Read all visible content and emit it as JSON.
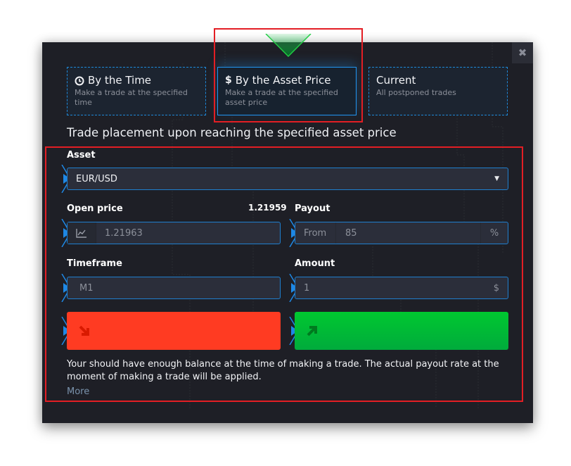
{
  "dialog": {
    "close_icon": "close-icon"
  },
  "tabs": [
    {
      "title": "By the Time",
      "description": "Make a trade at the specified time",
      "icon": "clock-icon",
      "active": false
    },
    {
      "title": "By the Asset Price",
      "description": "Make a trade at the specified asset price",
      "icon": "dollar-icon",
      "active": true
    },
    {
      "title": "Current",
      "description": "All postponed trades",
      "icon": "",
      "active": false
    }
  ],
  "heading": "Trade placement upon reaching the specified asset price",
  "form": {
    "asset": {
      "label": "Asset",
      "value": "EUR/USD"
    },
    "open_price": {
      "label": "Open price",
      "current_price": "1.21959",
      "value": "1.21963",
      "icon": "chart-line-icon"
    },
    "payout": {
      "label": "Payout",
      "prefix": "From",
      "value": "85",
      "suffix": "%"
    },
    "timeframe": {
      "label": "Timeframe",
      "value": "M1"
    },
    "amount": {
      "label": "Amount",
      "value": "1",
      "suffix": "$"
    },
    "sell_button": {
      "icon": "arrow-down-right-icon",
      "color": "#ff3b22"
    },
    "buy_button": {
      "icon": "arrow-up-right-icon",
      "color": "#00c032"
    }
  },
  "note": "Your should have enough balance at the time of making a trade. The actual payout rate at the moment of making a trade will be applied.",
  "more_link": "More",
  "annotation_color": "#e31e24"
}
